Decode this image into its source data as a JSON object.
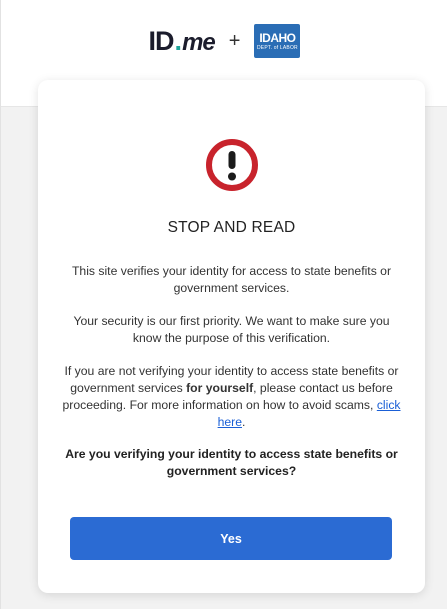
{
  "header": {
    "idme_logo": {
      "id": "ID",
      "dot": ".",
      "me": "me"
    },
    "plus": "+",
    "state_logo": {
      "line1": "IDAHO",
      "line2": "DEPT. of LABOR"
    }
  },
  "card": {
    "title": "STOP AND READ",
    "paragraph1": "This site verifies your identity for access to state benefits or government services.",
    "paragraph2": "Your security is our first priority. We want to make sure you know the purpose of this verification.",
    "paragraph3": {
      "before": "If you are not verifying your identity to access state benefits or government services ",
      "bold": "for yourself",
      "after": ", please contact us before proceeding. For more information on how to avoid scams, ",
      "link": "click here",
      "end": "."
    },
    "question": "Are you verifying your identity to access state benefits or government services?",
    "yes_label": "Yes"
  },
  "colors": {
    "accent": "#2b6bd3",
    "alert": "#c8232c",
    "link": "#1a5fd6",
    "idme_dot": "#1ea59a",
    "state_logo_bg": "#2a6db5"
  }
}
